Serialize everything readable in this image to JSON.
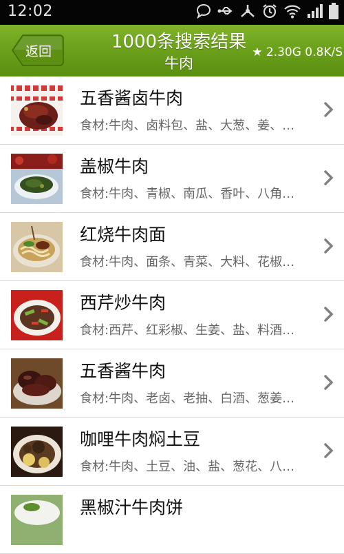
{
  "status_bar": {
    "time": "12:02",
    "icons": [
      "chat-bubble-icon",
      "usb-icon",
      "share-icon",
      "alarm-icon",
      "wifi-icon",
      "signal-icon",
      "battery-icon"
    ]
  },
  "header": {
    "back_label": "返回",
    "title": "1000条搜索结果",
    "subtitle": "牛肉",
    "stats": "★ 2.30G  0.8K/S"
  },
  "colors": {
    "header_green": "#6aa01a",
    "status_black": "#050505"
  },
  "results": [
    {
      "title": "五香酱卤牛肉",
      "ingredients": "食材:牛肉、卤料包、盐、大葱、姜、…",
      "thumb": "braised-beef-photo"
    },
    {
      "title": "盖椒牛肉",
      "ingredients": "食材:牛肉、青椒、南瓜、香叶、八角…",
      "thumb": "pepper-beef-photo"
    },
    {
      "title": "红烧牛肉面",
      "ingredients": "食材:牛肉、面条、青菜、大料、花椒…",
      "thumb": "beef-noodle-photo"
    },
    {
      "title": "西芹炒牛肉",
      "ingredients": "食材:西芹、红彩椒、生姜、盐、料酒…",
      "thumb": "celery-beef-photo"
    },
    {
      "title": "五香酱牛肉",
      "ingredients": "食材:牛肉、老卤、老抽、白酒、葱姜…",
      "thumb": "spiced-beef-photo"
    },
    {
      "title": "咖哩牛肉焖土豆",
      "ingredients": "食材:牛肉、土豆、油、盐、葱花、八…",
      "thumb": "curry-beef-photo"
    },
    {
      "title": "黑椒汁牛肉饼",
      "ingredients": "",
      "thumb": "beef-patty-photo"
    }
  ]
}
